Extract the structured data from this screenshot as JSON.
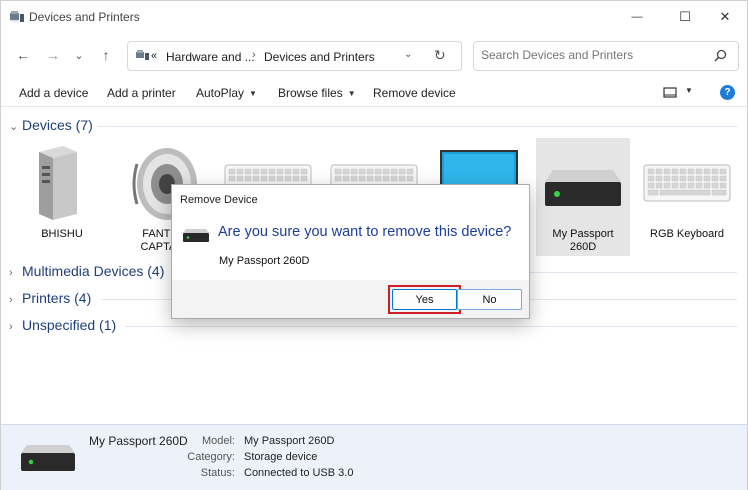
{
  "window": {
    "title": "Devices and Printers",
    "controls": {
      "minimize": "—",
      "maximize": "☐",
      "close": "✕"
    }
  },
  "nav": {
    "back": "←",
    "forward": "→",
    "dropdown": "⌄",
    "up": "↑",
    "breadcrumb": [
      "«",
      "Hardware and ...",
      "Devices and Printers"
    ],
    "separator": "›",
    "address_dropdown": "⌄",
    "refresh": "↻",
    "search_placeholder": "Search Devices and Printers"
  },
  "commands": {
    "add_device": "Add a device",
    "add_printer": "Add a printer",
    "autoplay": "AutoPlay",
    "browse_files": "Browse files",
    "remove_device": "Remove device",
    "caret": "▼",
    "help": "?"
  },
  "groups": {
    "devices": {
      "label": "Devices (7)",
      "chevron": "⌄"
    },
    "multimedia": {
      "label": "Multimedia Devices (4)",
      "chevron": "›"
    },
    "printers": {
      "label": "Printers (4)",
      "chevron": "›"
    },
    "unspecified": {
      "label": "Unspecified (1)",
      "chevron": "›"
    }
  },
  "devices": [
    {
      "name": "BHISHU",
      "icon": "computer-tower-icon"
    },
    {
      "name": "FANT CAPTA",
      "line1": "FANTE",
      "line2": "CAPTAI",
      "icon": "speaker-icon"
    },
    {
      "name": "",
      "icon": "keyboard-icon"
    },
    {
      "name": "",
      "icon": "keyboard-icon"
    },
    {
      "name": "",
      "icon": "monitor-icon"
    },
    {
      "name": "My Passport 260D",
      "line1": "My Passport",
      "line2": "260D",
      "icon": "external-drive-icon",
      "selected": true
    },
    {
      "name": "RGB Keyboard",
      "icon": "keyboard-icon"
    }
  ],
  "dialog": {
    "title": "Remove Device",
    "question": "Are you sure you want to remove this device?",
    "device_name": "My Passport 260D",
    "yes_label": "Yes",
    "no_label": "No"
  },
  "details": {
    "name": "My Passport 260D",
    "fields": [
      {
        "key": "Model:",
        "value": "My Passport 260D"
      },
      {
        "key": "Category:",
        "value": "Storage device"
      },
      {
        "key": "Status:",
        "value": "Connected to USB 3.0"
      }
    ]
  },
  "colors": {
    "group_header": "#1f3f7a",
    "dialog_question": "#1b3e9c",
    "highlight_box": "#cc1f2b",
    "details_bg": "#edf2fa",
    "help_button": "#1e7bd7"
  }
}
